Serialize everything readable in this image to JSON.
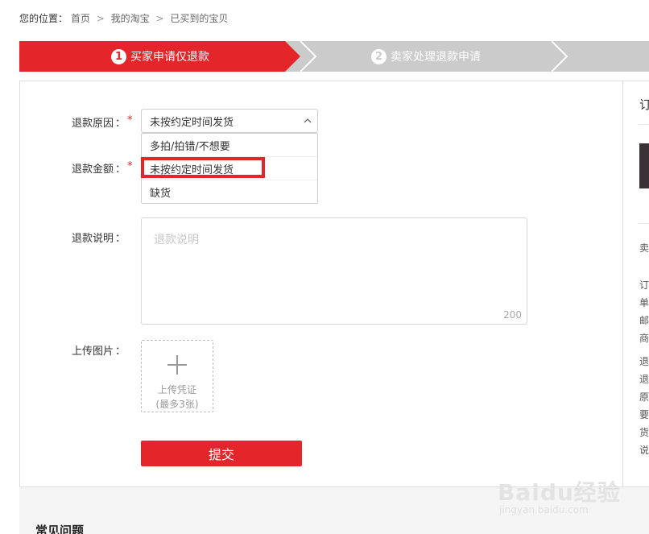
{
  "breadcrumb": {
    "label": "您的位置：",
    "items": [
      "首页",
      "我的淘宝",
      "已买到的宝贝"
    ],
    "separator": ">"
  },
  "steps": [
    {
      "number": "1",
      "label": "买家申请仅退款",
      "active": true
    },
    {
      "number": "2",
      "label": "卖家处理退款申请",
      "active": false
    }
  ],
  "form": {
    "reason_label": "退款原因",
    "amount_label": "退款金额",
    "desc_label": "退款说明",
    "upload_label": "上传图片",
    "colon": "：",
    "required_mark": "*",
    "reason_selected": "未按约定时间发货",
    "reason_options": [
      "多拍/拍错/不想要",
      "未按约定时间发货",
      "缺货"
    ],
    "desc_placeholder": "退款说明",
    "desc_max": "200",
    "upload_text": "上传凭证",
    "upload_limit": "(最多3张)",
    "submit_label": "提交"
  },
  "side": {
    "title": "订",
    "seller_char": "卖",
    "chars": [
      "订",
      "单",
      "邮",
      "商",
      "退",
      "退",
      "原",
      "要",
      "货",
      "说"
    ]
  },
  "bottom": {
    "faq_title": "常见问题"
  },
  "watermark": {
    "logo": "Baidu经验",
    "url": "jingyan.baidu.com"
  },
  "colors": {
    "accent": "#e4252a",
    "step_inactive": "#cbcbcb"
  }
}
